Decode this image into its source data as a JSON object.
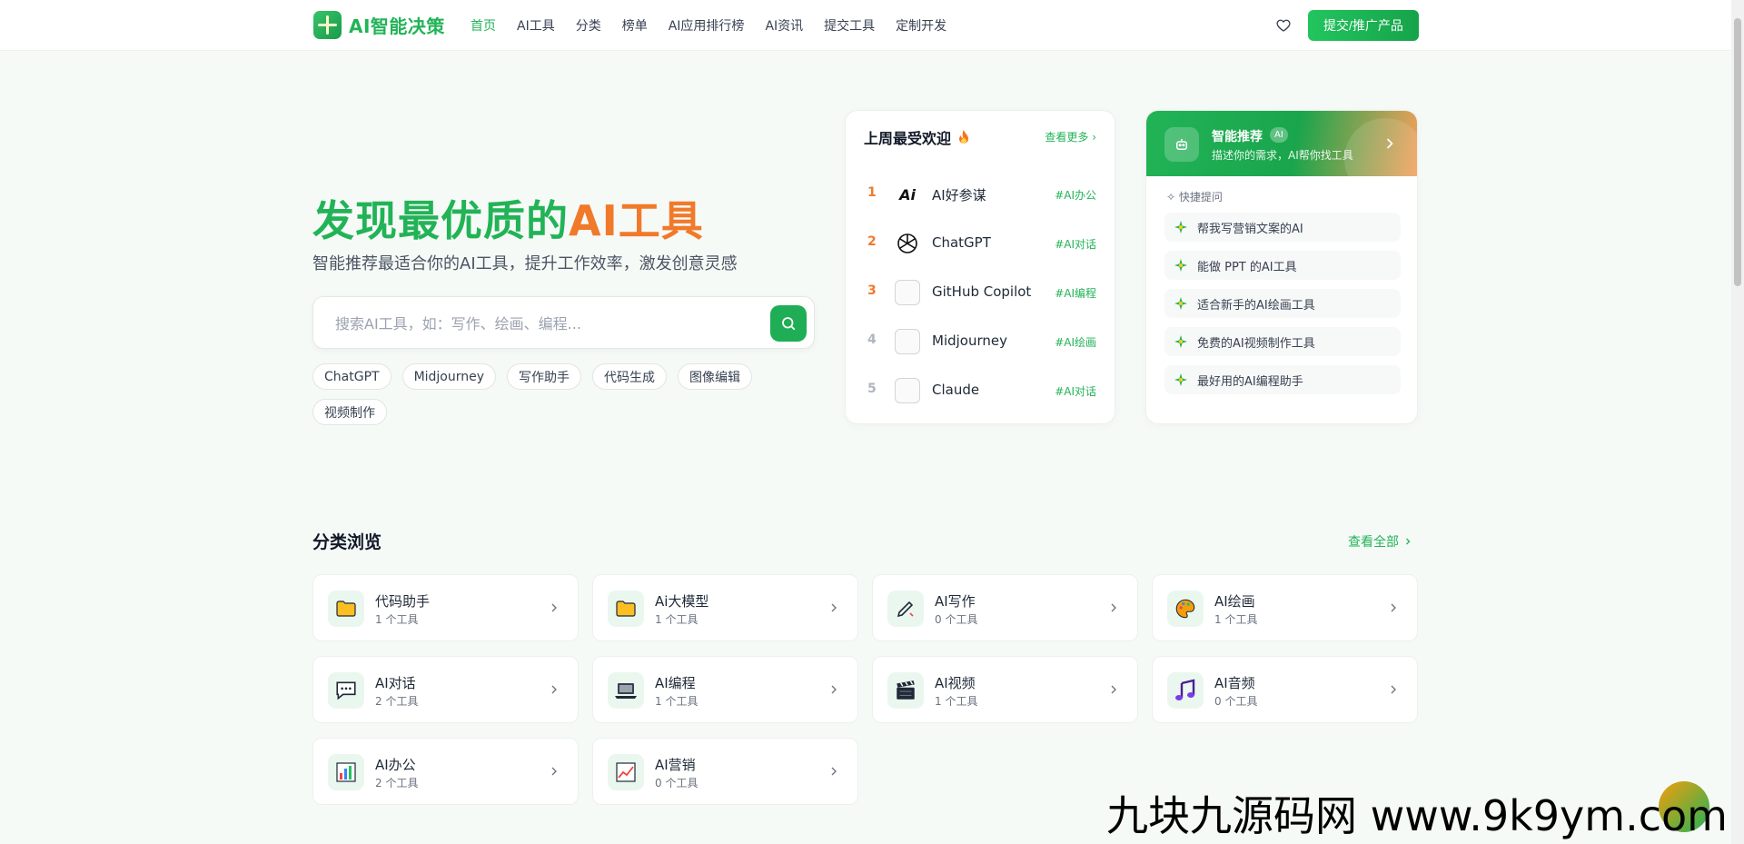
{
  "header": {
    "logo_text": "AI智能决策",
    "nav": [
      "首页",
      "AI工具",
      "分类",
      "榜单",
      "AI应用排行榜",
      "AI资讯",
      "提交工具",
      "定制开发"
    ],
    "submit_label": "提交/推广产品"
  },
  "hero": {
    "title_main": "发现最优质的",
    "title_accent": "AI工具",
    "subtitle": "智能推荐最适合你的AI工具，提升工作效率，激发创意灵感",
    "search_placeholder": "搜索AI工具，如：写作、绘画、编程...",
    "tags": [
      "ChatGPT",
      "Midjourney",
      "写作助手",
      "代码生成",
      "图像编辑",
      "视频制作"
    ]
  },
  "popular": {
    "title": "上周最受欢迎",
    "more": "查看更多",
    "items": [
      {
        "rank": "1",
        "name": "AI好参谋",
        "tag": "#AI办公",
        "logo": "Ai"
      },
      {
        "rank": "2",
        "name": "ChatGPT",
        "tag": "#AI对话",
        "logo": ""
      },
      {
        "rank": "3",
        "name": "GitHub Copilot",
        "tag": "#AI编程",
        "logo": ""
      },
      {
        "rank": "4",
        "name": "Midjourney",
        "tag": "#AI绘画",
        "logo": ""
      },
      {
        "rank": "5",
        "name": "Claude",
        "tag": "#AI对话",
        "logo": ""
      }
    ],
    "rank_colors": [
      "#f07a2a",
      "#f07a2a",
      "#f07a2a",
      "#b0b6bd",
      "#b0b6bd"
    ]
  },
  "smart": {
    "title": "智能推荐",
    "badge": "AI",
    "desc": "描述你的需求，AI帮你找工具",
    "quick_label": "快捷提问",
    "items": [
      "帮我写营销文案的AI",
      "能做 PPT 的AI工具",
      "适合新手的AI绘画工具",
      "免费的AI视频制作工具",
      "最好用的AI编程助手"
    ]
  },
  "categories": {
    "title": "分类浏览",
    "view_all": "查看全部",
    "items": [
      {
        "name": "代码助手",
        "count": "1 个工具",
        "icon": "folder-icon"
      },
      {
        "name": "Ai大模型",
        "count": "1 个工具",
        "icon": "folder-icon"
      },
      {
        "name": "AI写作",
        "count": "0 个工具",
        "icon": "pen-icon"
      },
      {
        "name": "AI绘画",
        "count": "1 个工具",
        "icon": "palette-icon"
      },
      {
        "name": "AI对话",
        "count": "2 个工具",
        "icon": "chat-icon"
      },
      {
        "name": "AI编程",
        "count": "1 个工具",
        "icon": "laptop-icon"
      },
      {
        "name": "AI视频",
        "count": "1 个工具",
        "icon": "clapper-icon"
      },
      {
        "name": "AI音频",
        "count": "0 个工具",
        "icon": "music-icon"
      },
      {
        "name": "AI办公",
        "count": "2 个工具",
        "icon": "bar-chart-icon"
      },
      {
        "name": "AI营销",
        "count": "0 个工具",
        "icon": "trend-chart-icon"
      }
    ]
  },
  "watermark": "九块九源码网 www.9k9ym.com",
  "colors": {
    "brand": "#22b357",
    "accent": "#f07a2a"
  }
}
